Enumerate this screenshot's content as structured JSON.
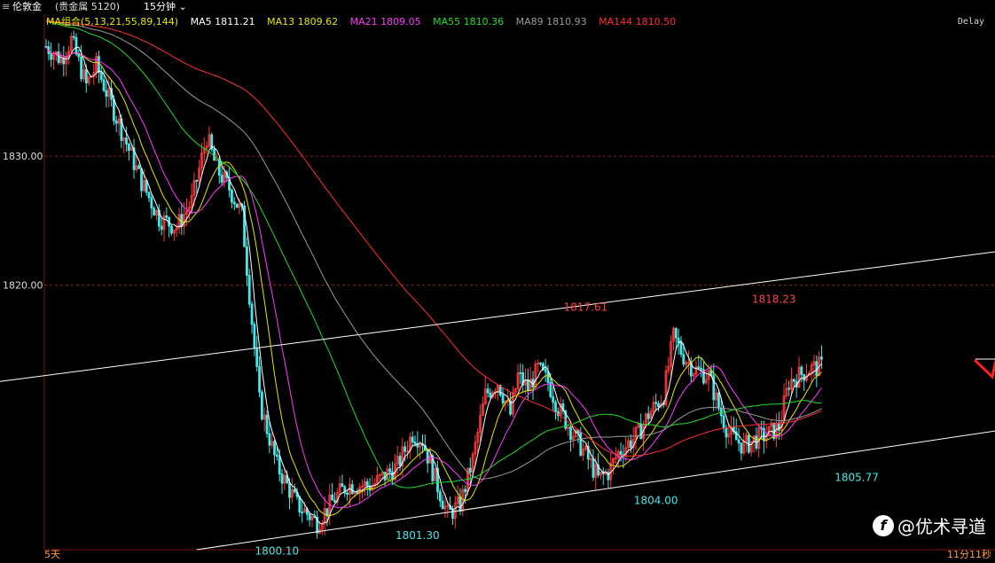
{
  "header": {
    "symbol": "伦敦金",
    "group": "(贵金属 5120)",
    "period": "15分钟"
  },
  "ma_legend": [
    {
      "label": "MA组合(5,13,21,55,89,144)",
      "color": "#e6e600"
    },
    {
      "label": "MA5 1811.21",
      "color": "#ffffff"
    },
    {
      "label": "MA13 1809.62",
      "color": "#e6e600"
    },
    {
      "label": "MA21 1809.05",
      "color": "#ff3bff"
    },
    {
      "label": "MA55 1810.36",
      "color": "#22dd22"
    },
    {
      "label": "MA89 1810.93",
      "color": "#9a9a9a"
    },
    {
      "label": "MA144 1810.50",
      "color": "#ff3030"
    }
  ],
  "status": {
    "delay": "Delay",
    "range": "5天",
    "timer": "11分11秒"
  },
  "watermark": "@优术寻道",
  "chart_data": {
    "type": "candlestick",
    "ylim": [
      1799.5,
      1841
    ],
    "y_ticks": [
      1820.0,
      1830.0
    ],
    "grid": "horizontal dashed at ticks",
    "candle_count": 310,
    "price_path": [
      [
        0,
        1838.5
      ],
      [
        6,
        1837.5
      ],
      [
        10,
        1839
      ],
      [
        16,
        1835.5
      ],
      [
        20,
        1837
      ],
      [
        28,
        1833
      ],
      [
        38,
        1828
      ],
      [
        45,
        1825.2
      ],
      [
        52,
        1824.5
      ],
      [
        58,
        1826.5
      ],
      [
        64,
        1831.5
      ],
      [
        68,
        1829
      ],
      [
        73,
        1827.5
      ],
      [
        78,
        1825.5
      ],
      [
        85,
        1811
      ],
      [
        92,
        1806
      ],
      [
        100,
        1803
      ],
      [
        108,
        1801.6
      ],
      [
        115,
        1803.5
      ],
      [
        120,
        1804.5
      ],
      [
        130,
        1804.5
      ],
      [
        140,
        1806
      ],
      [
        146,
        1808.5
      ],
      [
        150,
        1808
      ],
      [
        155,
        1805
      ],
      [
        160,
        1802.2
      ],
      [
        165,
        1803
      ],
      [
        170,
        1806.5
      ],
      [
        175,
        1811.5
      ],
      [
        180,
        1812.5
      ],
      [
        185,
        1810
      ],
      [
        188,
        1813
      ],
      [
        192,
        1812
      ],
      [
        196,
        1813.5
      ],
      [
        200,
        1812.5
      ],
      [
        204,
        1810.5
      ],
      [
        210,
        1808.5
      ],
      [
        216,
        1806.5
      ],
      [
        220,
        1805
      ],
      [
        224,
        1805.5
      ],
      [
        228,
        1807
      ],
      [
        236,
        1808.5
      ],
      [
        240,
        1810
      ],
      [
        246,
        1811.5
      ],
      [
        250,
        1816
      ],
      [
        254,
        1814.5
      ],
      [
        258,
        1813.5
      ],
      [
        264,
        1813
      ],
      [
        268,
        1810.5
      ],
      [
        272,
        1808.5
      ],
      [
        278,
        1807.5
      ],
      [
        282,
        1808
      ],
      [
        288,
        1808.5
      ],
      [
        292,
        1809
      ],
      [
        296,
        1812.5
      ],
      [
        300,
        1813
      ],
      [
        304,
        1813.5
      ],
      [
        309,
        1813.7
      ]
    ],
    "annotations": [
      {
        "text": "1817.61",
        "i": 215,
        "price": 1817.61,
        "place": "above",
        "color": "#ff4040"
      },
      {
        "text": "1818.23",
        "i": 290,
        "price": 1818.23,
        "place": "above",
        "color": "#ff4040"
      },
      {
        "text": "1800.10",
        "i": 92,
        "price": 1800.1,
        "place": "below",
        "color": "#44e8e8"
      },
      {
        "text": "1801.30",
        "i": 148,
        "price": 1801.3,
        "place": "below",
        "color": "#44e8e8"
      },
      {
        "text": "1804.00",
        "i": 243,
        "price": 1804.0,
        "place": "below",
        "color": "#44e8e8"
      },
      {
        "text": "1805.77",
        "i": 323,
        "price": 1805.77,
        "place": "below",
        "color": "#44e8e8"
      }
    ],
    "channel_upper": [
      [
        -20,
        1812.5
      ],
      [
        430,
        1823.9
      ]
    ],
    "channel_lower": [
      [
        60,
        1799.5
      ],
      [
        430,
        1810.2
      ]
    ],
    "projection_arrow": [
      [
        370,
        1814.2
      ],
      [
        377,
        1812.9
      ],
      [
        387,
        1821.6
      ],
      [
        393,
        1818.8
      ],
      [
        395,
        1816.9
      ],
      [
        399,
        1821.3
      ],
      [
        402,
        1818.8
      ],
      [
        404,
        1816.9
      ],
      [
        407,
        1821.6
      ],
      [
        412,
        1818.6
      ],
      [
        415,
        1820.0
      ],
      [
        420,
        1831.2
      ]
    ],
    "colors": {
      "up": "#ff3a3a",
      "down": "#45e8e8",
      "arrow": "#ff2020",
      "channel": "#ffffff",
      "grid": "#8a1e1e",
      "axis": "#7a1414"
    }
  }
}
